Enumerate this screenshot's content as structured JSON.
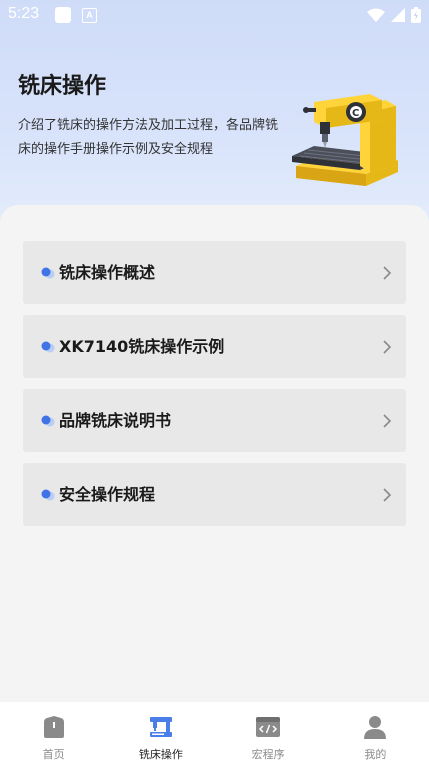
{
  "status_bar": {
    "time": "5:23",
    "notification_badge": "A"
  },
  "header": {
    "title": "铣床操作",
    "description": "介绍了铣床的操作方法及加工过程，各品牌铣床的操作手册操作示例及安全规程"
  },
  "menu": {
    "items": [
      {
        "label": "铣床操作概述"
      },
      {
        "label": "XK7140铣床操作示例"
      },
      {
        "label": "品牌铣床说明书"
      },
      {
        "label": "安全操作规程"
      }
    ]
  },
  "tabbar": {
    "active_index": 1,
    "items": [
      {
        "label": "首页",
        "icon": "home-icon"
      },
      {
        "label": "铣床操作",
        "icon": "milling-machine-icon"
      },
      {
        "label": "宏程序",
        "icon": "code-window-icon"
      },
      {
        "label": "我的",
        "icon": "user-icon"
      }
    ]
  },
  "colors": {
    "accent_blue": "#3f73e6",
    "active_tab_icon": "#4a7ee8",
    "inactive_tab_icon": "#8a8a8a"
  }
}
